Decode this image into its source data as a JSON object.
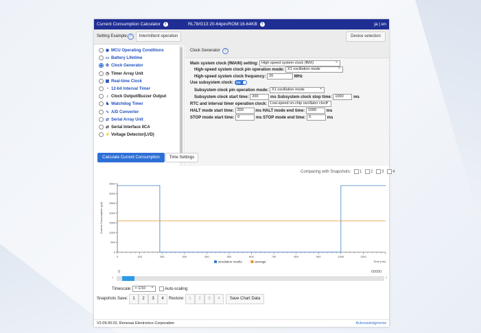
{
  "titlebar": {
    "app_title": "Current Consumption Calculator",
    "device": "RL78/G13 20-64pin/ROM:16-64KB",
    "lang": "ja | en"
  },
  "setting_example": {
    "label": "Setting Example:",
    "button": "Intermittent operation",
    "device_selection": "Device selection"
  },
  "menu": [
    {
      "label": "MCU Operating Conditions",
      "blue": true,
      "selected": false,
      "icon": "chip-icon"
    },
    {
      "label": "Battery Lifetime",
      "blue": true,
      "selected": false,
      "icon": "battery-icon"
    },
    {
      "label": "Clock Generator",
      "blue": true,
      "selected": true,
      "icon": "clock-generator-icon"
    },
    {
      "label": "Timer Array Unit",
      "blue": false,
      "selected": false,
      "icon": "timer-icon"
    },
    {
      "label": "Real-time Clock",
      "blue": true,
      "selected": false,
      "icon": "calendar-icon"
    },
    {
      "label": "12-bit Interval Timer",
      "blue": true,
      "selected": false,
      "icon": "interval-timer-icon"
    },
    {
      "label": "Clock Output/Buzzer Output",
      "blue": false,
      "selected": false,
      "icon": "buzzer-icon"
    },
    {
      "label": "Watchdog Timer",
      "blue": true,
      "selected": false,
      "icon": "watchdog-icon"
    },
    {
      "label": "A/D Converter",
      "blue": true,
      "selected": false,
      "icon": "ad-converter-icon"
    },
    {
      "label": "Serial Array Unit",
      "blue": true,
      "selected": false,
      "icon": "serial-icon"
    },
    {
      "label": "Serial Interface IICA",
      "blue": false,
      "selected": false,
      "icon": "serial-iica-icon"
    },
    {
      "label": "Voltage Detector(LVD)",
      "blue": false,
      "selected": false,
      "icon": "voltage-icon"
    }
  ],
  "clock_generator": {
    "header": "Clock Generator",
    "main_clock_label": "Main system clock (fMAIN) setting:",
    "main_clock_value": "High-speed system clock (fMX)",
    "hs_pin_mode_label": "High-speed system clock pin operation mode:",
    "hs_pin_mode_value": "X1 oscillation mode",
    "hs_freq_label": "High-speed system clock frequency:",
    "hs_freq_value": "20",
    "hs_freq_unit": "MHz",
    "use_sub_label": "Use subsystem clock:",
    "use_sub_toggle": "ON",
    "sub_pin_mode_label": "Subsystem clock pin operation mode:",
    "sub_pin_mode_value": "X1 oscillation mode",
    "sub_start_label": "Subsystem clock start time:",
    "sub_start_value": "200",
    "sub_stop_label": "Subsystem clock stop time:",
    "sub_stop_value": "1000",
    "rtc_label": "RTC and interval timer operation clock:",
    "rtc_value": "Low-speed on-chip oscillator clock",
    "halt_start_label": "HALT mode start time:",
    "halt_start_value": "200",
    "halt_end_label": "HALT mode end time:",
    "halt_end_value": "1000",
    "stop_start_label": "STOP mode start time:",
    "stop_start_value": "0",
    "stop_end_label": "STOP mode end time:",
    "stop_end_value": "0",
    "unit_ms": "ms"
  },
  "tabs": {
    "calculate": "Calculate Current Consumption",
    "time_settings": "Time Settings"
  },
  "comparing": {
    "label": "Comparing with Snapshots:",
    "options": [
      "1",
      "2",
      "3",
      "4"
    ]
  },
  "chart_data": {
    "type": "line",
    "ylabel": "Current Consumption (µA)",
    "xlabel": "Time (ms)",
    "y_ticks": [
      "3500",
      "3000",
      "2500",
      "2000",
      "1500",
      "1000",
      "500",
      "0"
    ],
    "x_ticks": [
      "0",
      "100",
      "200",
      "300",
      "400",
      "500",
      "600",
      "700",
      "800",
      "900",
      "1000",
      "1100"
    ],
    "xlim": [
      0,
      1200
    ],
    "ylim": [
      0,
      3500
    ],
    "series": [
      {
        "name": "simulation results",
        "color": "#3b7dc4",
        "points": [
          [
            0,
            3400
          ],
          [
            190,
            3400
          ],
          [
            190,
            0
          ],
          [
            1000,
            0
          ],
          [
            1000,
            3400
          ],
          [
            1200,
            3400
          ]
        ]
      },
      {
        "name": "average",
        "color": "#e8912f",
        "points": [
          [
            0,
            1600
          ],
          [
            1200,
            1600
          ]
        ]
      }
    ]
  },
  "scroller": {
    "left_label": "0",
    "right_label": "00000",
    "position": 0.02
  },
  "timescale": {
    "label": "Timescale:",
    "value": "× 1/10",
    "autoscaling": "Auto-scaling"
  },
  "snapshots": {
    "save_label": "Snapshots Save:",
    "save_buttons": [
      "1",
      "2",
      "3",
      "4"
    ],
    "restore_label": "Restore:",
    "restore_buttons": [
      "1",
      "2",
      "3",
      "4"
    ],
    "save_chart": "Save Chart Data"
  },
  "footer": {
    "version": "V2.09.00.02, Renesas Electronics Corporation",
    "ack": "Acknowledgments"
  }
}
